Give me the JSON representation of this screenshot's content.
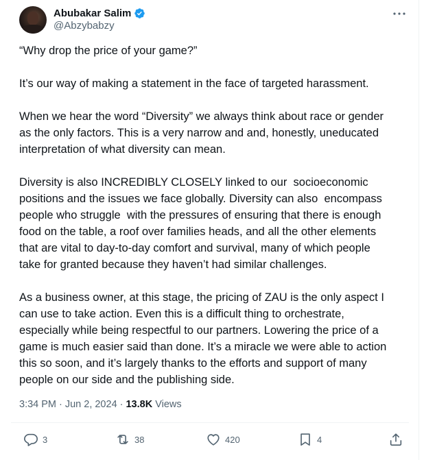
{
  "author": {
    "display_name": "Abubakar Salim",
    "handle": "@Abzybabzy"
  },
  "tweet": {
    "paragraphs": [
      "“Why drop the price of your game?”",
      "It’s our way of making a statement in the face of targeted harassment.",
      "When we hear the word “Diversity” we always think about race or gender\nas the only factors. This is a very narrow and and, honestly, uneducated\ninterpretation of what diversity can mean.",
      "Diversity is also INCREDIBLY CLOSELY linked to our  socioeconomic\npositions and the issues we face globally. Diversity can also  encompass\npeople who struggle  with the pressures of ensuring that there is enough\nfood on the table, a roof over families heads, and all the other elements\nthat are vital to day-to-day comfort and survival, many of which people\ntake for granted because they haven’t had similar challenges.",
      "As a business owner, at this stage, the pricing of ZAU is the only aspect I\ncan use to take action. Even this is a difficult thing to orchestrate,\nespecially while being respectful to our partners. Lowering the price of a\ngame is much easier said than done. It’s a miracle we were able to action\nthis so soon, and it’s largely thanks to the efforts and support of many\npeople on our side and the publishing side."
    ]
  },
  "meta": {
    "time": "3:34 PM",
    "separator": "·",
    "date": "Jun 2, 2024",
    "views_count": "13.8K",
    "views_label": "Views"
  },
  "actions": {
    "replies": "3",
    "reposts": "38",
    "likes": "420",
    "bookmarks": "4"
  },
  "colors": {
    "verified": "#1d9bf0",
    "text_primary": "#0f1419",
    "text_secondary": "#536471",
    "divider": "#eff3f4"
  },
  "icons": {
    "verified": "verified-badge-icon",
    "more": "more-horizontal-icon",
    "reply": "reply-bubble-icon",
    "repost": "repost-arrows-icon",
    "like": "heart-icon",
    "bookmark": "bookmark-icon",
    "share": "share-upload-icon"
  }
}
